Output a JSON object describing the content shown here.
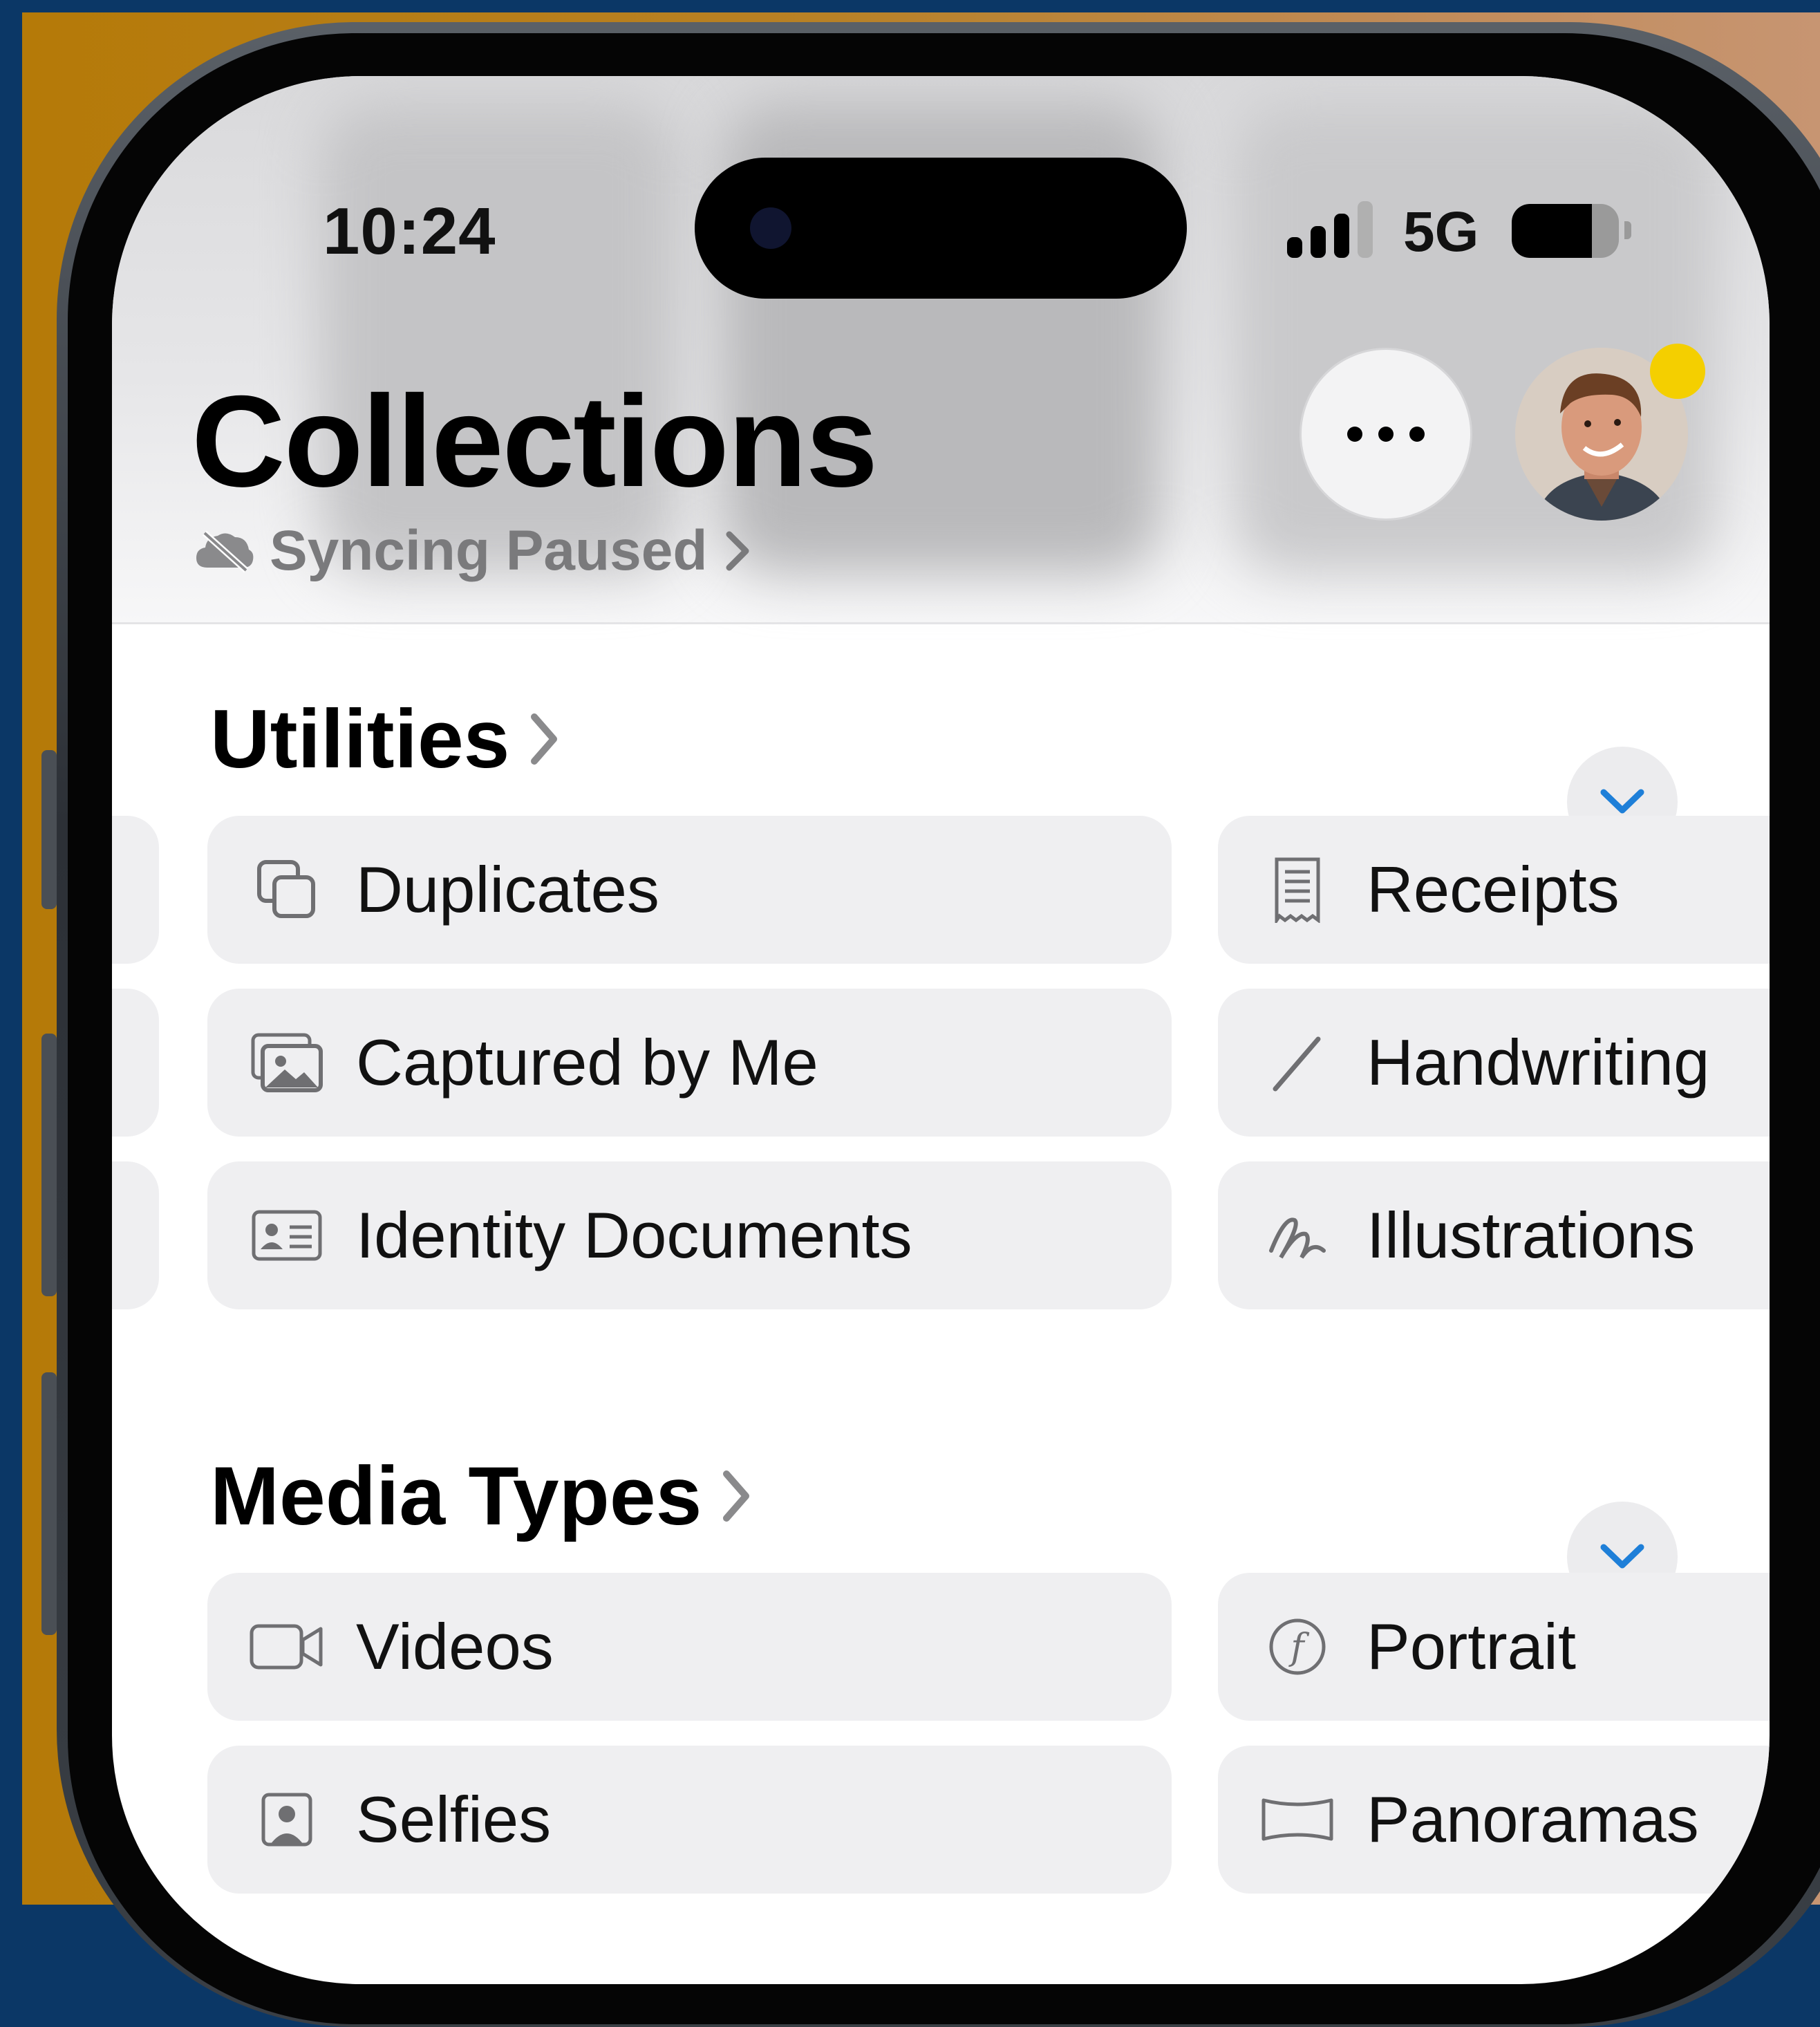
{
  "status_bar": {
    "time": "10:24",
    "network": "5G",
    "signal_bars": 3,
    "signal_bars_total": 4,
    "battery_level": 0.75
  },
  "header": {
    "title": "Collections",
    "sync_status": "Syncing Paused",
    "notification_badge_color": "#F4CF00"
  },
  "sections": [
    {
      "title": "Utilities",
      "items": [
        {
          "label": "Duplicates",
          "icon": "duplicates-icon"
        },
        {
          "label": "Receipts",
          "icon": "receipt-icon"
        },
        {
          "label": "Captured by Me",
          "icon": "photo-stack-icon"
        },
        {
          "label": "Handwriting",
          "icon": "pencil-icon"
        },
        {
          "label": "Identity Documents",
          "icon": "id-card-icon"
        },
        {
          "label": "Illustrations",
          "icon": "scribble-icon"
        }
      ]
    },
    {
      "title": "Media Types",
      "items": [
        {
          "label": "Videos",
          "icon": "video-camera-icon"
        },
        {
          "label": "Portrait",
          "icon": "aperture-icon"
        },
        {
          "label": "Selfies",
          "icon": "selfie-icon"
        },
        {
          "label": "Panoramas",
          "icon": "panorama-icon"
        }
      ]
    }
  ],
  "colors": {
    "accent": "#1E7FD8",
    "tile_background": "#EFEFF1",
    "secondary_text": "#7A7A7C"
  }
}
